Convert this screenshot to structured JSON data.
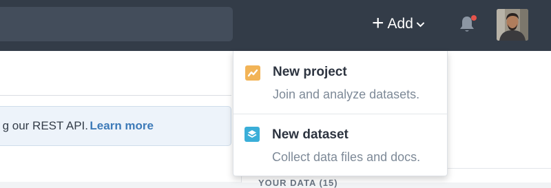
{
  "header": {
    "add_label": "Add"
  },
  "banner": {
    "text": "g our REST API.",
    "link": "Learn more"
  },
  "add_menu": {
    "items": [
      {
        "title": "New project",
        "desc": "Join and analyze datasets.",
        "icon": "project-chart-icon",
        "color": "#f2b457"
      },
      {
        "title": "New dataset",
        "desc": "Collect data files and docs.",
        "icon": "dataset-layers-icon",
        "color": "#3aaed8"
      }
    ]
  },
  "right_panel": {
    "cut_label": "YOUR DATA (15)"
  },
  "colors": {
    "topbar": "#333c48",
    "notification_dot": "#e5534b",
    "link": "#3d7ab8"
  }
}
